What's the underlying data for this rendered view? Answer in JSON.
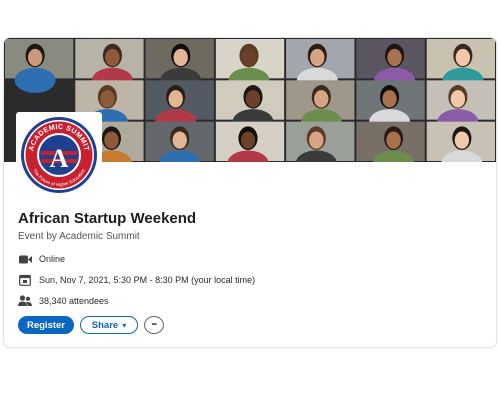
{
  "event": {
    "title": "African Startup Weekend",
    "organizer_line": "Event by Academic Summit",
    "location": "Online",
    "datetime": "Sun, Nov 7, 2021, 5:30 PM - 8:30 PM (your local time)",
    "attendees": "38,340 attendees"
  },
  "actions": {
    "register_label": "Register",
    "share_label": "Share",
    "share_caret": "▾",
    "more_label": "•••"
  },
  "logo": {
    "top_text": "ACADEMIC SUMMIT",
    "bottom_text": "The Future of Higher Education",
    "letter": "A",
    "colors": {
      "red": "#c8202e",
      "blue": "#1f3f8f"
    }
  },
  "icons": {
    "location": "video-camera-icon",
    "date": "calendar-icon",
    "attendees": "people-icon",
    "more": "ellipsis-icon"
  },
  "colors": {
    "accent": "#0a66c2",
    "banner_bg": "#2b2a2d"
  }
}
